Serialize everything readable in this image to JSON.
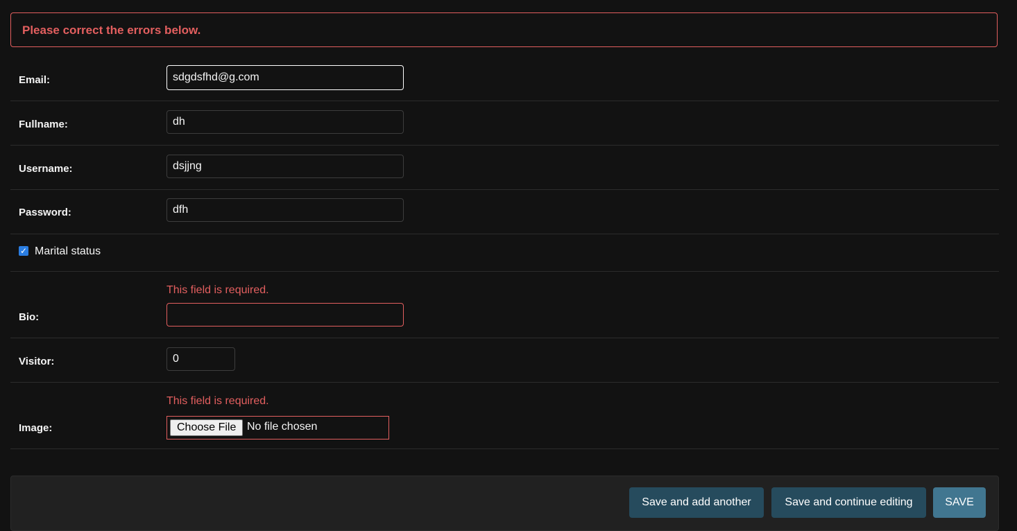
{
  "errornote": "Please correct the errors below.",
  "fields": {
    "email": {
      "label": "Email:",
      "value": "sdgdsfhd@g.com"
    },
    "fullname": {
      "label": "Fullname:",
      "value": "dh"
    },
    "username": {
      "label": "Username:",
      "value": "dsjjng"
    },
    "password": {
      "label": "Password:",
      "value": "dfh"
    },
    "marital_status": {
      "label": "Marital status",
      "checked": true
    },
    "bio": {
      "label": "Bio:",
      "value": "",
      "error": "This field is required."
    },
    "visitor": {
      "label": "Visitor:",
      "value": "0"
    },
    "image": {
      "label": "Image:",
      "button": "Choose File",
      "status": "No file chosen",
      "error": "This field is required."
    }
  },
  "buttons": {
    "save_add_another": "Save and add another",
    "save_continue": "Save and continue editing",
    "save": "SAVE"
  },
  "colors": {
    "background": "#121212",
    "error": "#e35f5f",
    "button": "#264b5d",
    "button_default": "#417690",
    "checkbox": "#2a7de1"
  }
}
